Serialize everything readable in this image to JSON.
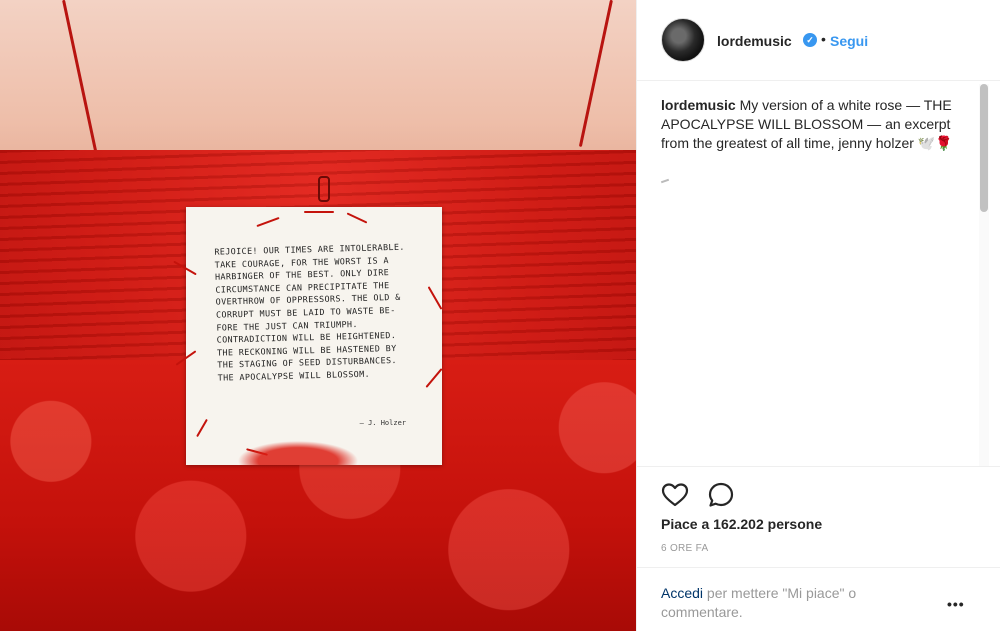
{
  "post": {
    "card": {
      "lines": [
        "Rejoice! Our times are intolerable.",
        "Take courage, for the worst is a",
        "harbinger of the best. Only dire",
        "circumstance can precipitate the",
        "overthrow of oppressors. The old &",
        "corrupt must be laid to waste be-",
        "fore the just can triumph.",
        "Contradiction will be heightened.",
        "The reckoning will be hastened by",
        "the staging of seed disturbances.",
        "The apocalypse will blossom."
      ],
      "signature": "— J. Holzer"
    }
  },
  "header": {
    "username": "lordemusic",
    "verified_glyph": "✓",
    "separator": "•",
    "follow_label": "Segui"
  },
  "caption": {
    "username": "lordemusic",
    "text": " My version of a white rose — THE APOCALYPSE WILL BLOSSOM — an excerpt from the greatest of all time, jenny holzer 🕊️🌹"
  },
  "actions": {
    "like_icon": "heart-icon",
    "comment_icon": "comment-icon",
    "likes_text": "Piace a 162.202 persone",
    "time_text": "6 ORE FA"
  },
  "login": {
    "link_text": "Accedi",
    "rest_text": " per mettere \"Mi piace\" o commentare.",
    "more_label": "•••"
  }
}
